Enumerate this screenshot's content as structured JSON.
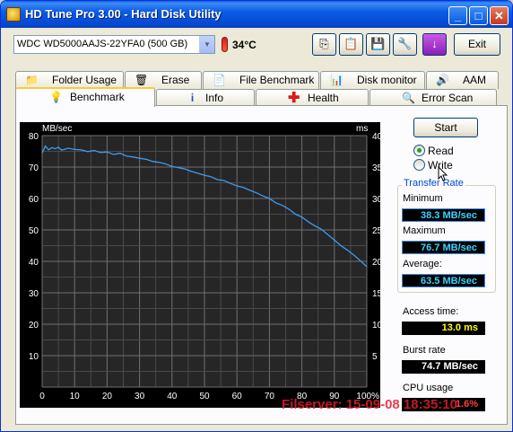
{
  "window": {
    "title": "HD Tune Pro 3.00 - Hard Disk Utility"
  },
  "toolbar": {
    "drive": "WDC WD5000AAJS-22YFA0 (500 GB)",
    "temperature": "34°C",
    "exit_label": "Exit"
  },
  "tabs_top": [
    "Folder Usage",
    "Erase",
    "File Benchmark",
    "Disk monitor",
    "AAM"
  ],
  "tabs_bottom": [
    "Benchmark",
    "Info",
    "Health",
    "Error Scan"
  ],
  "controls": {
    "start_label": "Start",
    "read_label": "Read",
    "write_label": "Write",
    "selected_mode": "Read"
  },
  "stats": {
    "group_title": "Transfer Rate",
    "minimum_label": "Minimum",
    "minimum_value": "38.3 MB/sec",
    "maximum_label": "Maximum",
    "maximum_value": "76.7 MB/sec",
    "average_label": "Average:",
    "average_value": "63.5 MB/sec",
    "access_label": "Access time:",
    "access_value": "13.0 ms",
    "burst_label": "Burst rate",
    "burst_value": "74.7 MB/sec",
    "cpu_label": "CPU usage",
    "cpu_value": "1.6%"
  },
  "watermark": "Filserver: 15-09-08 18:35:10",
  "chart_data": {
    "type": "line",
    "left_unit": "MB/sec",
    "right_unit": "ms",
    "x_ticks": [
      "0",
      "10",
      "20",
      "30",
      "40",
      "50",
      "60",
      "70",
      "80",
      "90",
      "100%"
    ],
    "y_left_ticks": [
      10,
      20,
      30,
      40,
      50,
      60,
      70,
      80
    ],
    "y_right_ticks": [
      5,
      10,
      15,
      20,
      25,
      30,
      35,
      40
    ],
    "ylim_left": [
      0,
      80
    ],
    "ylim_right": [
      0,
      40
    ],
    "xlim": [
      0,
      100
    ],
    "grid": true,
    "series": [
      {
        "color": "#3c9cf0",
        "axis": "left",
        "x": [
          0,
          1,
          2,
          3,
          4,
          5,
          6,
          8,
          10,
          12,
          14,
          16,
          18,
          20,
          22,
          24,
          26,
          28,
          30,
          32,
          34,
          36,
          38,
          40,
          42,
          44,
          46,
          48,
          50,
          52,
          54,
          56,
          58,
          60,
          62,
          64,
          66,
          68,
          70,
          72,
          74,
          76,
          78,
          80,
          82,
          84,
          86,
          88,
          90,
          92,
          94,
          96,
          98,
          100
        ],
        "y": [
          74.5,
          76.7,
          75.5,
          76.2,
          75.8,
          76.3,
          75.4,
          76.0,
          75.6,
          75.5,
          74.9,
          75.3,
          74.6,
          74.8,
          74.0,
          74.4,
          73.5,
          73.2,
          72.8,
          72.5,
          71.8,
          71.5,
          71.0,
          70.2,
          69.8,
          69.4,
          68.6,
          68.0,
          67.4,
          66.9,
          66.0,
          65.7,
          64.8,
          64.0,
          63.5,
          62.6,
          61.8,
          60.8,
          60.0,
          58.6,
          57.8,
          56.6,
          55.0,
          54.1,
          52.6,
          51.3,
          50.2,
          48.5,
          46.8,
          45.0,
          43.6,
          42.0,
          40.2,
          38.3
        ]
      }
    ]
  }
}
